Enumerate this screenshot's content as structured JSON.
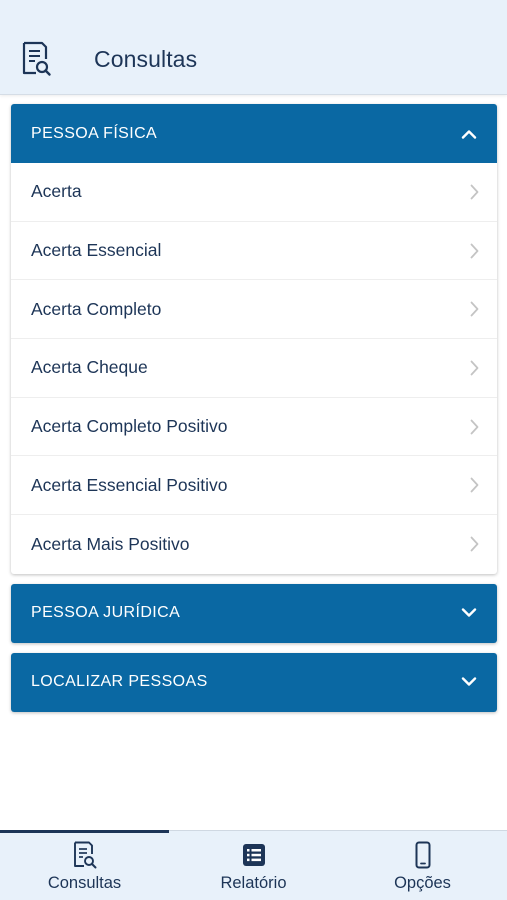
{
  "header": {
    "title": "Consultas",
    "icon": "document-search-icon"
  },
  "accordion": {
    "sections": [
      {
        "title": "PESSOA FÍSICA",
        "expanded": true,
        "items": [
          "Acerta",
          "Acerta Essencial",
          "Acerta Completo",
          "Acerta Cheque",
          "Acerta Completo Positivo",
          "Acerta Essencial Positivo",
          "Acerta Mais Positivo"
        ]
      },
      {
        "title": "PESSOA JURÍDICA",
        "expanded": false,
        "items": []
      },
      {
        "title": "LOCALIZAR PESSOAS",
        "expanded": false,
        "items": []
      }
    ]
  },
  "bottom_nav": {
    "active": "Consultas",
    "items": [
      {
        "label": "Consultas",
        "icon": "document-search-icon"
      },
      {
        "label": "Relatório",
        "icon": "list-icon"
      },
      {
        "label": "Opções",
        "icon": "phone-icon"
      }
    ]
  },
  "colors": {
    "primary": "#0a68a3",
    "text": "#1d3557",
    "header_bg": "#e8f1fa"
  }
}
